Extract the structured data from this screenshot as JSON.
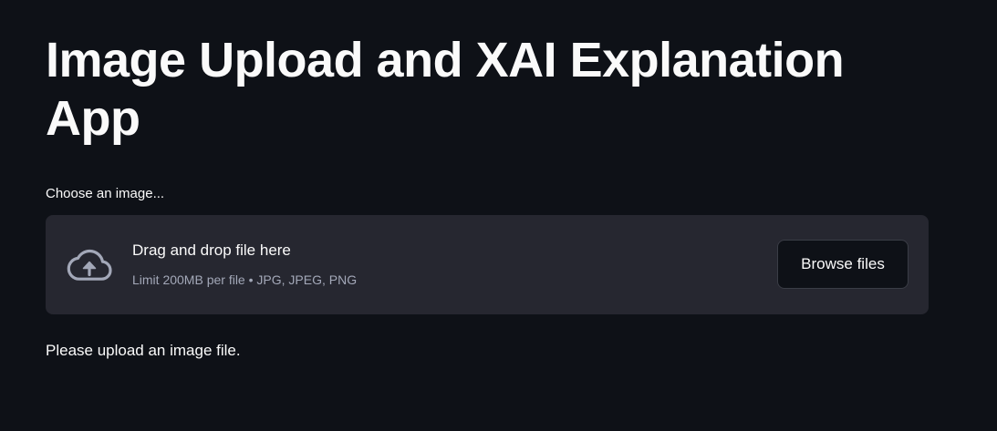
{
  "page": {
    "title": "Image Upload and XAI Explanation App"
  },
  "uploader": {
    "label": "Choose an image...",
    "dropzone_title": "Drag and drop file here",
    "limit_text": "Limit 200MB per file • JPG, JPEG, PNG",
    "browse_label": "Browse files",
    "icon": "cloud-upload-icon"
  },
  "message": {
    "text": "Please upload an image file."
  },
  "colors": {
    "background": "#0e1117",
    "dropzone_bg": "#262730",
    "text": "#fafafa",
    "muted_text": "#a3a8b8"
  }
}
